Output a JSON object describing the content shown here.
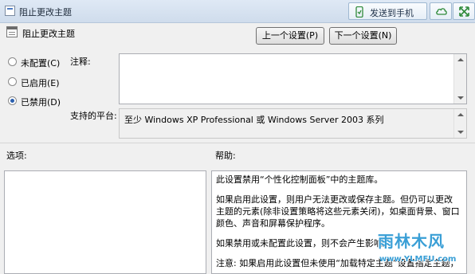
{
  "window": {
    "title": "阻止更改主题",
    "accent": "#3a9fd6"
  },
  "toolbar": {
    "send_to_phone": "发送到手机",
    "cloud_icon": "cloud-icon",
    "expand_icon": "expand-icon"
  },
  "policy": {
    "name": "阻止更改主题",
    "prev_button": "上一个设置(P)",
    "next_button": "下一个设置(N)"
  },
  "state": {
    "options": [
      {
        "label": "未配置(C)",
        "selected": false
      },
      {
        "label": "已启用(E)",
        "selected": false
      },
      {
        "label": "已禁用(D)",
        "selected": true
      }
    ]
  },
  "comment": {
    "label": "注释:",
    "value": ""
  },
  "platform": {
    "label": "支持的平台:",
    "value": "至少 Windows XP Professional 或 Windows Server 2003 系列"
  },
  "options_panel": {
    "label": "选项:"
  },
  "help": {
    "label": "帮助:",
    "paragraphs": [
      "此设置禁用“个性化控制面板”中的主题库。",
      "如果启用此设置，则用户无法更改或保存主题。但仍可以更改主题的元素(除非设置策略将这些元素关闭)，如桌面背景、窗口颜色、声音和屏幕保护程序。",
      "如果禁用或未配置此设置，则不会产生影响。",
      "注意: 如果启用此设置但未使用“加载特定主题”设置指定主题，"
    ]
  },
  "watermark": {
    "title": "雨林木风",
    "url": "www.YLMFU.com"
  }
}
